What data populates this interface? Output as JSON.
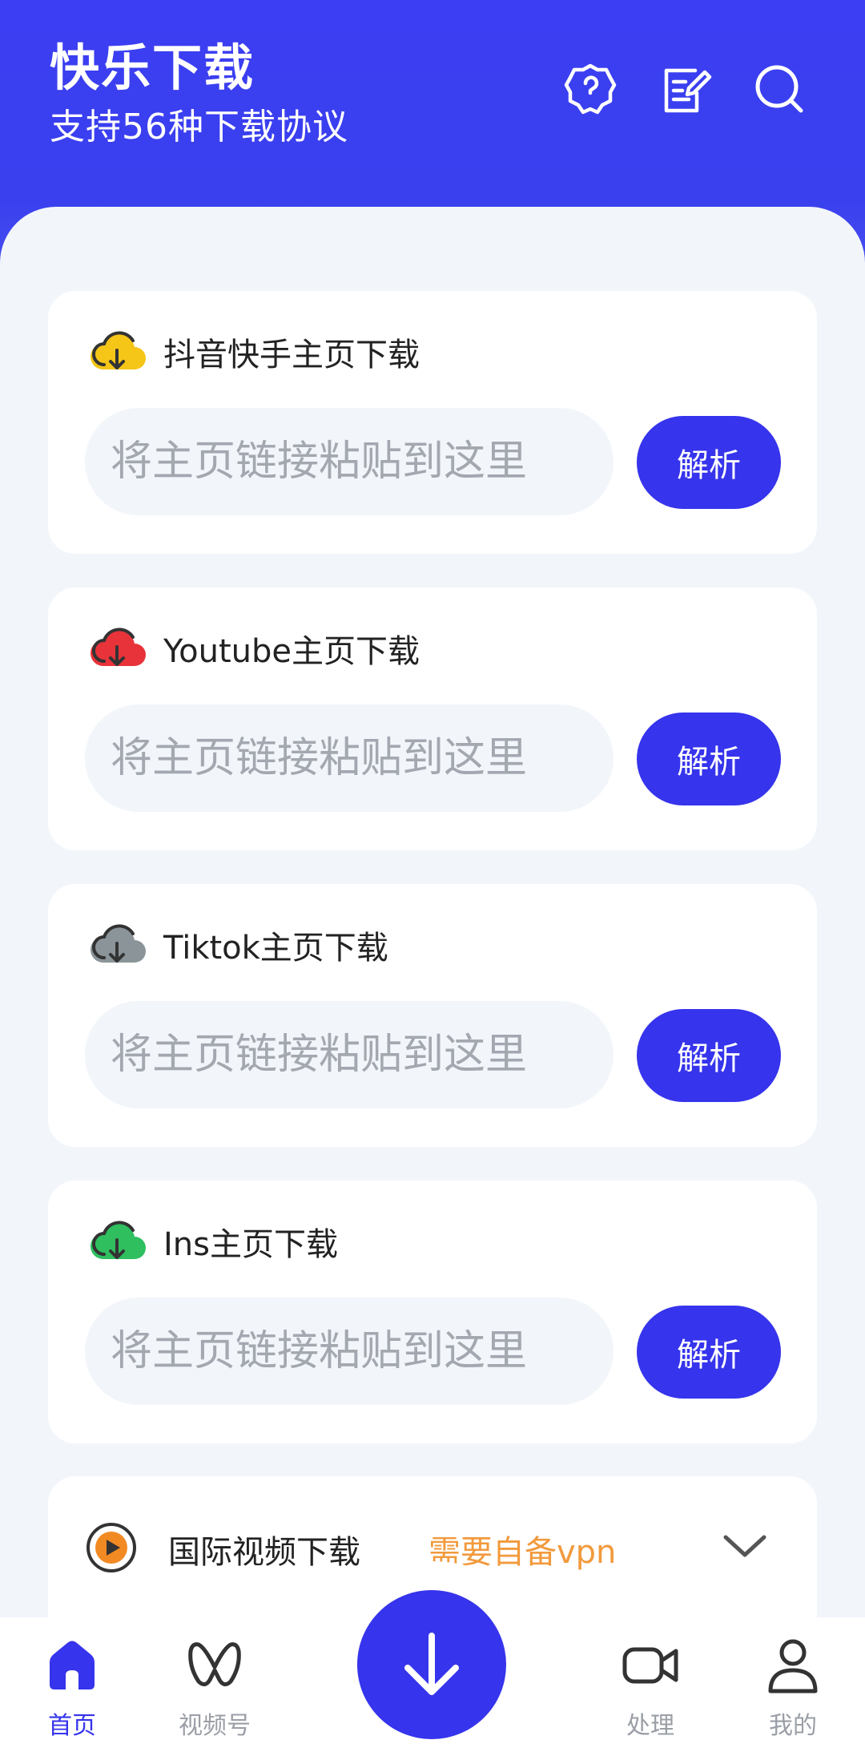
{
  "header": {
    "title": "快乐下载",
    "subtitle": "支持56种下载协议",
    "icons": [
      "settings-icon",
      "notes-icon",
      "search-icon"
    ]
  },
  "cards": [
    {
      "title": "抖音快手主页下载",
      "placeholder": "将主页链接粘贴到这里",
      "button": "解析",
      "icon_color": "#f5c518"
    },
    {
      "title": "Youtube主页下载",
      "placeholder": "将主页链接粘贴到这里",
      "button": "解析",
      "icon_color": "#e8333a"
    },
    {
      "title": "Tiktok主页下载",
      "placeholder": "将主页链接粘贴到这里",
      "button": "解析",
      "icon_color": "#8b9499"
    },
    {
      "title": "Ins主页下载",
      "placeholder": "将主页链接粘贴到这里",
      "button": "解析",
      "icon_color": "#2fbf5f"
    }
  ],
  "intl": {
    "title": "国际视频下载",
    "note": "需要自备vpn"
  },
  "nav": {
    "items": [
      {
        "label": "首页",
        "icon": "home-icon",
        "active": true
      },
      {
        "label": "视频号",
        "icon": "channels-icon",
        "active": false
      },
      {
        "label": "处理",
        "icon": "video-camera-icon",
        "active": false
      },
      {
        "label": "我的",
        "icon": "profile-icon",
        "active": false
      }
    ],
    "fab_icon": "download-arrow-icon"
  },
  "colors": {
    "primary": "#3634ec",
    "header_bg": "#3b3ef2",
    "note_orange": "#f29a3c",
    "page_bg": "#f2f6fb"
  }
}
